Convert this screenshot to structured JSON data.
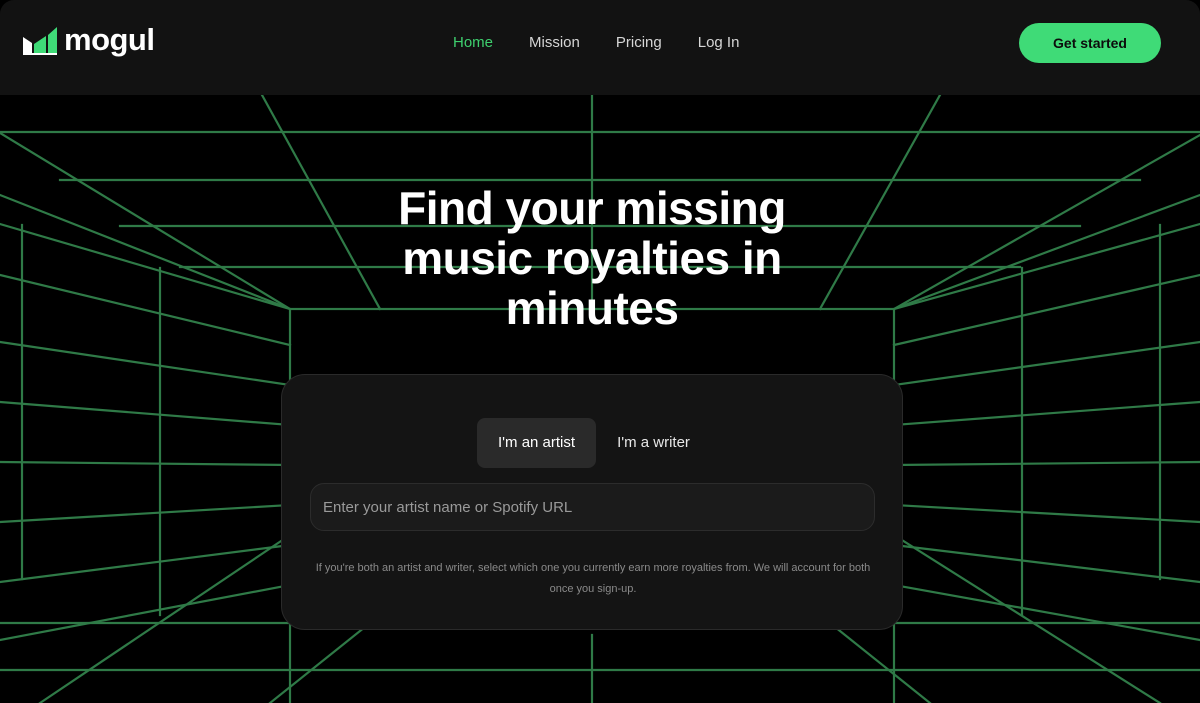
{
  "brand": {
    "name": "mogul",
    "accent": "#3fdb77"
  },
  "nav": {
    "items": [
      {
        "label": "Home",
        "active": true
      },
      {
        "label": "Mission",
        "active": false
      },
      {
        "label": "Pricing",
        "active": false
      },
      {
        "label": "Log In",
        "active": false
      }
    ],
    "cta_label": "Get started"
  },
  "hero": {
    "headline": "Find your missing music royalties in minutes",
    "tabs": [
      {
        "label": "I'm an artist",
        "selected": true
      },
      {
        "label": "I'm a writer",
        "selected": false
      }
    ],
    "search": {
      "placeholder": "Enter your artist name or Spotify URL",
      "value": ""
    },
    "note": "If you're both an artist and writer, select which one you currently earn more royalties from. We will account for both once you sign-up."
  },
  "icons": {
    "logo": "mogul-logo-icon"
  }
}
